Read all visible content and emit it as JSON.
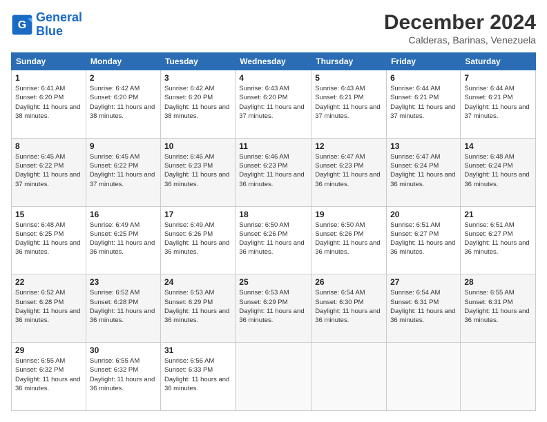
{
  "logo": {
    "line1": "General",
    "line2": "Blue"
  },
  "header": {
    "month": "December 2024",
    "location": "Calderas, Barinas, Venezuela"
  },
  "weekdays": [
    "Sunday",
    "Monday",
    "Tuesday",
    "Wednesday",
    "Thursday",
    "Friday",
    "Saturday"
  ],
  "weeks": [
    [
      {
        "day": "1",
        "sunrise": "6:41 AM",
        "sunset": "6:20 PM",
        "daylight": "11 hours and 38 minutes."
      },
      {
        "day": "2",
        "sunrise": "6:42 AM",
        "sunset": "6:20 PM",
        "daylight": "11 hours and 38 minutes."
      },
      {
        "day": "3",
        "sunrise": "6:42 AM",
        "sunset": "6:20 PM",
        "daylight": "11 hours and 38 minutes."
      },
      {
        "day": "4",
        "sunrise": "6:43 AM",
        "sunset": "6:20 PM",
        "daylight": "11 hours and 37 minutes."
      },
      {
        "day": "5",
        "sunrise": "6:43 AM",
        "sunset": "6:21 PM",
        "daylight": "11 hours and 37 minutes."
      },
      {
        "day": "6",
        "sunrise": "6:44 AM",
        "sunset": "6:21 PM",
        "daylight": "11 hours and 37 minutes."
      },
      {
        "day": "7",
        "sunrise": "6:44 AM",
        "sunset": "6:21 PM",
        "daylight": "11 hours and 37 minutes."
      }
    ],
    [
      {
        "day": "8",
        "sunrise": "6:45 AM",
        "sunset": "6:22 PM",
        "daylight": "11 hours and 37 minutes."
      },
      {
        "day": "9",
        "sunrise": "6:45 AM",
        "sunset": "6:22 PM",
        "daylight": "11 hours and 37 minutes."
      },
      {
        "day": "10",
        "sunrise": "6:46 AM",
        "sunset": "6:23 PM",
        "daylight": "11 hours and 36 minutes."
      },
      {
        "day": "11",
        "sunrise": "6:46 AM",
        "sunset": "6:23 PM",
        "daylight": "11 hours and 36 minutes."
      },
      {
        "day": "12",
        "sunrise": "6:47 AM",
        "sunset": "6:23 PM",
        "daylight": "11 hours and 36 minutes."
      },
      {
        "day": "13",
        "sunrise": "6:47 AM",
        "sunset": "6:24 PM",
        "daylight": "11 hours and 36 minutes."
      },
      {
        "day": "14",
        "sunrise": "6:48 AM",
        "sunset": "6:24 PM",
        "daylight": "11 hours and 36 minutes."
      }
    ],
    [
      {
        "day": "15",
        "sunrise": "6:48 AM",
        "sunset": "6:25 PM",
        "daylight": "11 hours and 36 minutes."
      },
      {
        "day": "16",
        "sunrise": "6:49 AM",
        "sunset": "6:25 PM",
        "daylight": "11 hours and 36 minutes."
      },
      {
        "day": "17",
        "sunrise": "6:49 AM",
        "sunset": "6:26 PM",
        "daylight": "11 hours and 36 minutes."
      },
      {
        "day": "18",
        "sunrise": "6:50 AM",
        "sunset": "6:26 PM",
        "daylight": "11 hours and 36 minutes."
      },
      {
        "day": "19",
        "sunrise": "6:50 AM",
        "sunset": "6:26 PM",
        "daylight": "11 hours and 36 minutes."
      },
      {
        "day": "20",
        "sunrise": "6:51 AM",
        "sunset": "6:27 PM",
        "daylight": "11 hours and 36 minutes."
      },
      {
        "day": "21",
        "sunrise": "6:51 AM",
        "sunset": "6:27 PM",
        "daylight": "11 hours and 36 minutes."
      }
    ],
    [
      {
        "day": "22",
        "sunrise": "6:52 AM",
        "sunset": "6:28 PM",
        "daylight": "11 hours and 36 minutes."
      },
      {
        "day": "23",
        "sunrise": "6:52 AM",
        "sunset": "6:28 PM",
        "daylight": "11 hours and 36 minutes."
      },
      {
        "day": "24",
        "sunrise": "6:53 AM",
        "sunset": "6:29 PM",
        "daylight": "11 hours and 36 minutes."
      },
      {
        "day": "25",
        "sunrise": "6:53 AM",
        "sunset": "6:29 PM",
        "daylight": "11 hours and 36 minutes."
      },
      {
        "day": "26",
        "sunrise": "6:54 AM",
        "sunset": "6:30 PM",
        "daylight": "11 hours and 36 minutes."
      },
      {
        "day": "27",
        "sunrise": "6:54 AM",
        "sunset": "6:31 PM",
        "daylight": "11 hours and 36 minutes."
      },
      {
        "day": "28",
        "sunrise": "6:55 AM",
        "sunset": "6:31 PM",
        "daylight": "11 hours and 36 minutes."
      }
    ],
    [
      {
        "day": "29",
        "sunrise": "6:55 AM",
        "sunset": "6:32 PM",
        "daylight": "11 hours and 36 minutes."
      },
      {
        "day": "30",
        "sunrise": "6:55 AM",
        "sunset": "6:32 PM",
        "daylight": "11 hours and 36 minutes."
      },
      {
        "day": "31",
        "sunrise": "6:56 AM",
        "sunset": "6:33 PM",
        "daylight": "11 hours and 36 minutes."
      },
      null,
      null,
      null,
      null
    ]
  ]
}
